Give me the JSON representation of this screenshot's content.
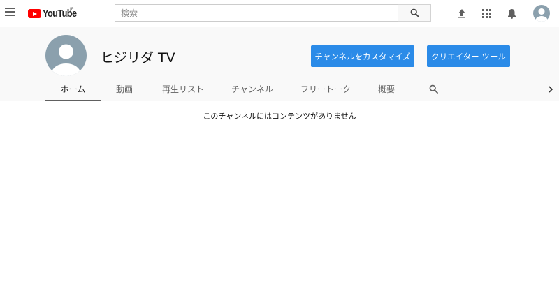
{
  "masthead": {
    "logo_text": "YouTube",
    "logo_region": "JP",
    "search_placeholder": "検索",
    "icons": [
      "menu-icon",
      "search-icon",
      "upload-icon",
      "apps-icon",
      "bell-icon",
      "account-icon"
    ]
  },
  "channel": {
    "name": "ヒジリダ TV",
    "customize_label": "チャンネルをカスタマイズ",
    "creator_tools_label": "クリエイター ツール"
  },
  "tabs": [
    {
      "label": "ホーム",
      "active": true
    },
    {
      "label": "動画"
    },
    {
      "label": "再生リスト"
    },
    {
      "label": "チャンネル"
    },
    {
      "label": "フリートーク"
    },
    {
      "label": "概要"
    }
  ],
  "content": {
    "empty_message": "このチャンネルにはコンテンツがありません"
  },
  "colors": {
    "brand_red": "#ff0000",
    "button_blue": "#2b8be8",
    "header_bg": "#f9f9f9",
    "avatar": "#8ba0ad"
  }
}
